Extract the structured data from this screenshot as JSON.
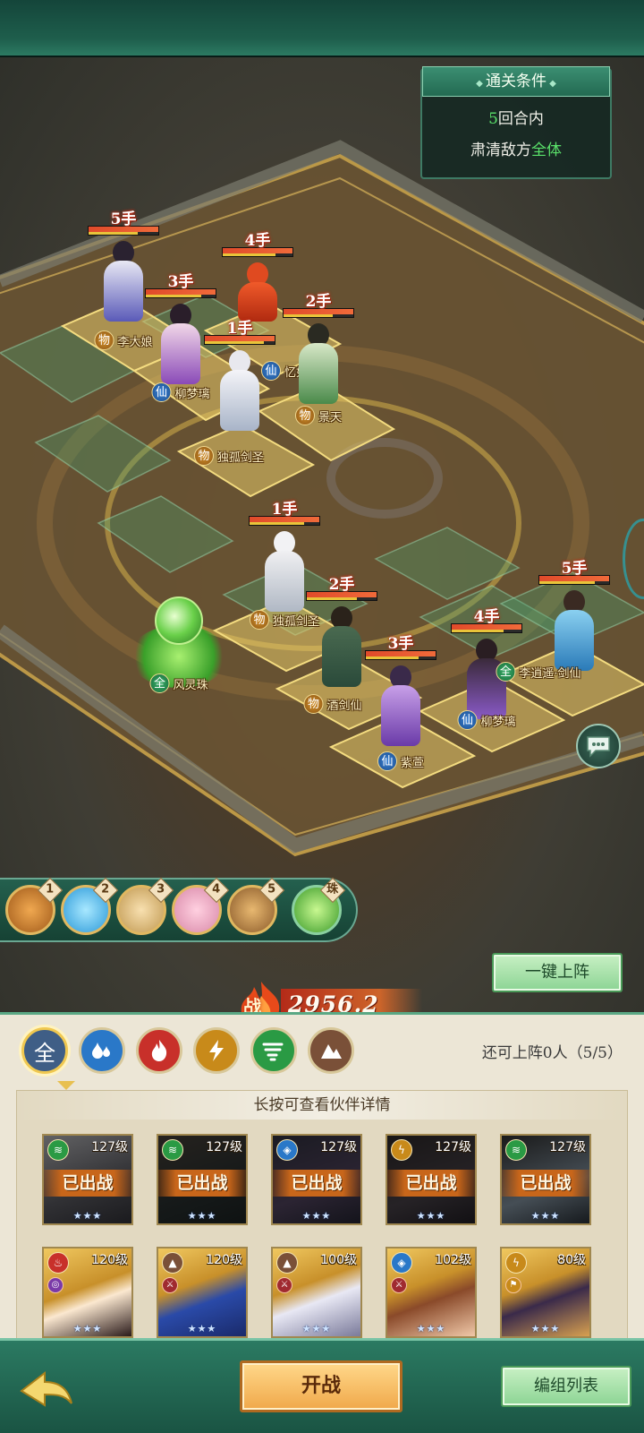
{
  "clear_condition": {
    "title": "通关条件",
    "rounds_num": "5",
    "rounds_text": "回合内",
    "goal_prefix": "肃清敌方",
    "goal_highlight": "全体"
  },
  "enemies": [
    {
      "order": "5手",
      "type": "物",
      "name": "李大娘"
    },
    {
      "order": "3手",
      "type": "仙",
      "name": "柳梦璃"
    },
    {
      "order": "4手",
      "type": "",
      "name": ""
    },
    {
      "order": "1手",
      "type": "仙",
      "name": "忆如"
    },
    {
      "order": "2手",
      "type": "物",
      "name": "景天"
    },
    {
      "order": "",
      "type": "物",
      "name": "独孤剑圣"
    }
  ],
  "allies": [
    {
      "order": "1手",
      "type": "物",
      "name": "独孤剑圣"
    },
    {
      "order": "",
      "type": "全",
      "name": "风灵珠"
    },
    {
      "order": "2手",
      "type": "物",
      "name": "酒剑仙"
    },
    {
      "order": "3手",
      "type": "仙",
      "name": "紫萱"
    },
    {
      "order": "4手",
      "type": "仙",
      "name": "柳梦璃"
    },
    {
      "order": "5手",
      "type": "全",
      "name": "李逍遥·剑仙"
    }
  ],
  "order_bar": {
    "slots": [
      "1",
      "2",
      "3",
      "4",
      "5"
    ],
    "pearl_label": "珠"
  },
  "power": {
    "label": "战",
    "value": "2956.2万"
  },
  "buttons": {
    "auto_deploy": "一键上阵",
    "start_battle": "开战",
    "group_list": "编组列表"
  },
  "element_filters": [
    {
      "icon": "all-icon",
      "label": "全",
      "color": "#3f5e86",
      "selected": true
    },
    {
      "icon": "water-icon",
      "label": "",
      "color": "#2a78c8"
    },
    {
      "icon": "fire-icon",
      "label": "",
      "color": "#c8302a"
    },
    {
      "icon": "thunder-icon",
      "label": "",
      "color": "#c88a1a"
    },
    {
      "icon": "wind-icon",
      "label": "",
      "color": "#2a9a44"
    },
    {
      "icon": "earth-icon",
      "label": "",
      "color": "#7a5038"
    }
  ],
  "remaining": "还可上阵0人（5/5）",
  "hint": "长按可查看伙伴详情",
  "deployed_label": "已出战",
  "partners_deployed": [
    {
      "level": "127级",
      "element": "wind",
      "elcolor": "#2a9a44"
    },
    {
      "level": "127级",
      "element": "wind",
      "elcolor": "#2a9a44"
    },
    {
      "level": "127级",
      "element": "water",
      "elcolor": "#2a78c8"
    },
    {
      "level": "127级",
      "element": "thunder",
      "elcolor": "#c88a1a"
    },
    {
      "level": "127级",
      "element": "wind",
      "elcolor": "#2a9a44"
    }
  ],
  "partners_available": [
    {
      "level": "120级",
      "element": "fire",
      "elcolor": "#c8302a"
    },
    {
      "level": "120级",
      "element": "earth",
      "elcolor": "#7a5038"
    },
    {
      "level": "100级",
      "element": "earth",
      "elcolor": "#7a5038"
    },
    {
      "level": "102级",
      "element": "water",
      "elcolor": "#2a78c8"
    },
    {
      "level": "80级",
      "element": "thunder",
      "elcolor": "#c88a1a"
    }
  ],
  "stars": "★★★"
}
